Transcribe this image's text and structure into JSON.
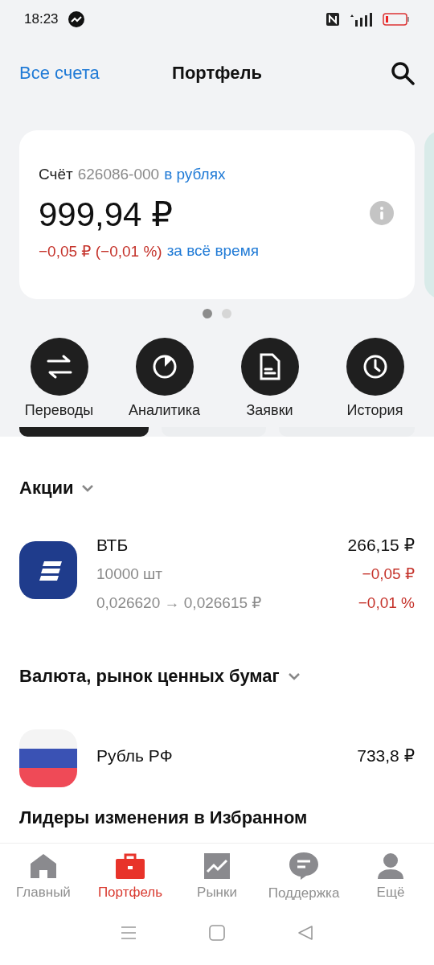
{
  "status_bar": {
    "time": "18:23"
  },
  "header": {
    "back_link": "Все счета",
    "title": "Портфель"
  },
  "account_card": {
    "label": "Счёт",
    "number": "626086-000",
    "currency_link": "в рублях",
    "balance": "999,94 ₽",
    "change": "−0,05 ₽ (−0,01 %)",
    "period_link": "за всё время"
  },
  "carousel_dots": [
    {
      "selected": true
    },
    {
      "selected": false
    }
  ],
  "actions": [
    {
      "label": "Переводы",
      "kind": "transfer"
    },
    {
      "label": "Аналитика",
      "kind": "analytics"
    },
    {
      "label": "Заявки",
      "kind": "orders"
    },
    {
      "label": "История",
      "kind": "history"
    }
  ],
  "sections": [
    {
      "title": "Акции",
      "items": [
        {
          "kind": "vtb",
          "name": "ВТБ",
          "quantity": "10000 шт",
          "price_change": "0,026620 → 0,026615 ₽",
          "value": "266,15 ₽",
          "change_abs": "−0,05 ₽",
          "change_pct": "−0,01 %"
        }
      ]
    },
    {
      "title": "Валюта, рынок ценных бумаг",
      "items": [
        {
          "kind": "rub",
          "name": "Рубль РФ",
          "value": "733,8 ₽"
        }
      ]
    },
    {
      "title": "Лидеры изменения в Избранном"
    }
  ],
  "bottom_nav": [
    {
      "label": "Главный",
      "kind": "home",
      "selected": false
    },
    {
      "label": "Портфель",
      "kind": "portfolio",
      "selected": true
    },
    {
      "label": "Рынки",
      "kind": "markets",
      "selected": false
    },
    {
      "label": "Поддержка",
      "kind": "support",
      "selected": false
    },
    {
      "label": "Ещё",
      "kind": "more",
      "selected": false
    }
  ]
}
